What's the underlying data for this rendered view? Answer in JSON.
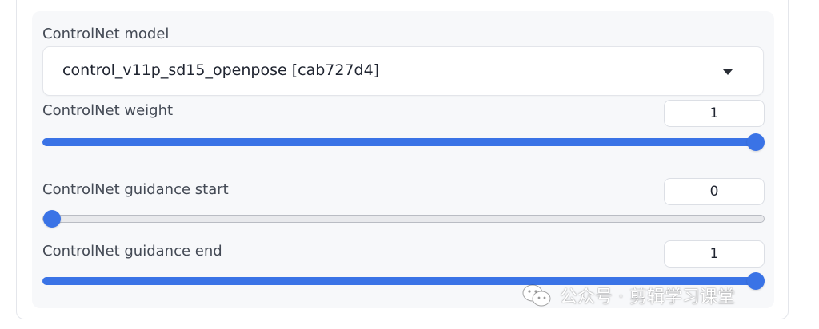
{
  "controlnet": {
    "model": {
      "label": "ControlNet model",
      "selected": "control_v11p_sd15_openpose [cab727d4]"
    },
    "weight": {
      "label": "ControlNet weight",
      "value": "1",
      "fraction": 1.0
    },
    "guidance_start": {
      "label": "ControlNet guidance start",
      "value": "0",
      "fraction": 0.0
    },
    "guidance_end": {
      "label": "ControlNet guidance end",
      "value": "1",
      "fraction": 1.0
    }
  },
  "watermark": {
    "text": "公众号 · 剪辑学习课堂"
  },
  "colors": {
    "accent": "#3a73e6",
    "panel_bg": "#f7f8fa",
    "track_empty": "#e8e9ec"
  }
}
